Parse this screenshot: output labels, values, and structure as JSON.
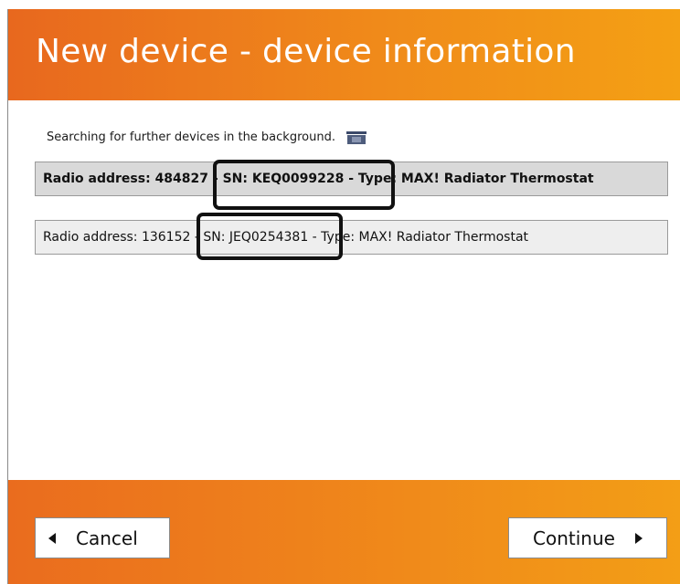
{
  "header": {
    "title": "New device - device information"
  },
  "status": {
    "text": "Searching for further devices in the background.",
    "icon": "device-searching-icon"
  },
  "devices": [
    {
      "label": "Radio address: 484827 - SN: KEQ0099228 - Type: MAX! Radiator Thermostat",
      "radio_address": "484827",
      "serial_number": "KEQ0099228",
      "type": "MAX! Radiator Thermostat",
      "selected": true
    },
    {
      "label": "Radio address: 136152 - SN: JEQ0254381 - Type: MAX! Radiator Thermostat",
      "radio_address": "136152",
      "serial_number": "JEQ0254381",
      "type": "MAX! Radiator Thermostat",
      "selected": false
    }
  ],
  "footer": {
    "cancel_label": "Cancel",
    "continue_label": "Continue"
  },
  "colors": {
    "header_start": "#e8681e",
    "header_end": "#f4a014",
    "selected_row": "#d9d9d9",
    "row": "#eeeeee"
  }
}
